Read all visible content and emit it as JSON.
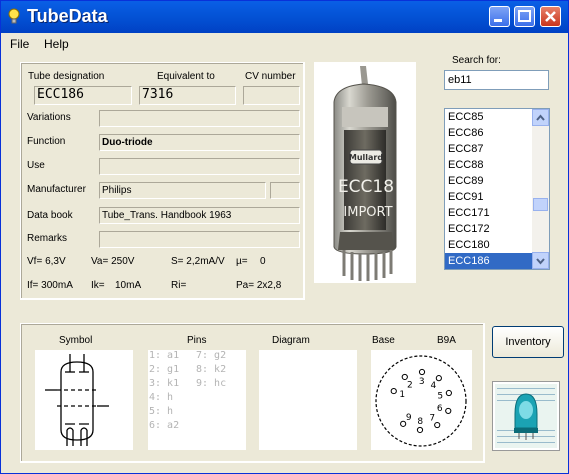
{
  "window": {
    "title": "TubeData"
  },
  "menu": {
    "items": [
      {
        "label": "File"
      },
      {
        "label": "Help"
      }
    ]
  },
  "tube_info": {
    "designation_label": "Tube designation",
    "designation_value": "ECC186",
    "equivalent_label": "Equivalent to",
    "equivalent_value": "7316",
    "cv_label": "CV number",
    "cv_value": "",
    "variations_label": "Variations",
    "variations_value": "",
    "function_label": "Function",
    "function_value": "Duo-triode",
    "use_label": "Use",
    "use_value": "",
    "manufacturer_label": "Manufacturer",
    "manufacturer_value": "Philips",
    "manufacturer_code": "",
    "databook_label": "Data book",
    "databook_value": "Tube_Trans. Handbook 1963",
    "remarks_label": "Remarks",
    "remarks_value": ""
  },
  "specs": {
    "vf": "Vf= 6,3V",
    "va": "Va= 250V",
    "s": "S= 2,2mA/V",
    "mu": "µ=",
    "mu_value": "0",
    "if": "If= 300mA",
    "ik": "Ik=",
    "ik_value": "10mA",
    "ri": "Ri=",
    "pa": "Pa= 2x2,8"
  },
  "photo": {
    "brand": "Mullard",
    "print": "ECC18",
    "import": "IMPORT"
  },
  "search": {
    "label": "Search for:",
    "value": "eb11"
  },
  "tube_list": {
    "items": [
      "ECC85",
      "ECC86",
      "ECC87",
      "ECC88",
      "ECC89",
      "ECC91",
      "ECC171",
      "ECC172",
      "ECC180",
      "ECC186"
    ],
    "selected": "ECC186"
  },
  "bottom": {
    "symbol_label": "Symbol",
    "pins_label": "Pins",
    "diagram_label": "Diagram",
    "base_label": "Base",
    "base_value": "B9A",
    "pins": [
      "1: a1",
      "2: g1",
      "3: k1",
      "4: h",
      "5: h",
      "6: a2",
      "7: g2",
      "8: k2",
      "9: hc"
    ],
    "base_numbers": [
      "1",
      "2",
      "3",
      "4",
      "5",
      "6",
      "7",
      "8",
      "9"
    ]
  },
  "buttons": {
    "inventory": "Inventory"
  },
  "colors": {
    "titlebar": "#0453d6",
    "selection": "#316ac5",
    "pin_text": "#b4b4b4"
  }
}
